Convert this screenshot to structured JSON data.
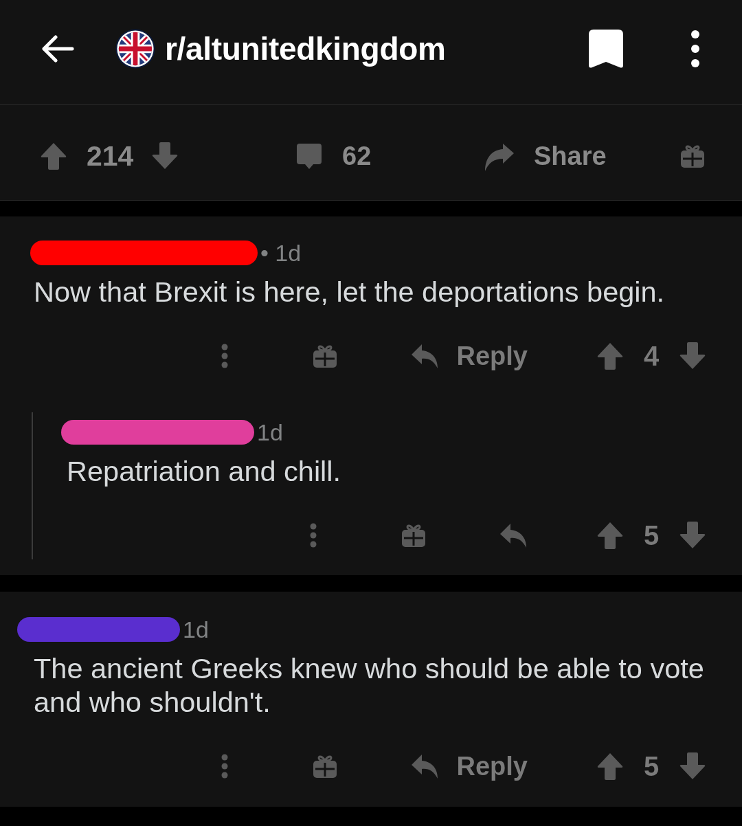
{
  "header": {
    "title": "r/altunitedkingdom"
  },
  "post_bar": {
    "score": "214",
    "comment_count": "62",
    "share_label": "Share"
  },
  "comments": [
    {
      "redaction": {
        "color": "#ff0000"
      },
      "time": "• 1d",
      "body": "Now that Brexit is here, let the deportations begin.",
      "reply_label": "Reply",
      "score": "4",
      "children": [
        {
          "redaction": {
            "color": "#e03e9c"
          },
          "time": "1d",
          "body": "Repatriation and chill.",
          "score": "5"
        }
      ]
    },
    {
      "redaction": {
        "color": "#5a2ecf"
      },
      "time": "1d",
      "body": "The ancient Greeks knew who should be able to vote and who shouldn't.",
      "reply_label": "Reply",
      "score": "5"
    }
  ]
}
